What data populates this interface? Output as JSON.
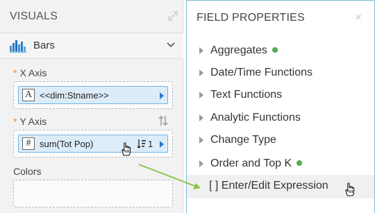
{
  "visuals": {
    "title": "VISUALS",
    "chart_type": "Bars",
    "x_axis": {
      "label": "X Axis",
      "required_mark": "*",
      "pill": {
        "type_glyph": "A",
        "text": "<<dim:Stname>>"
      }
    },
    "y_axis": {
      "label": "Y Axis",
      "required_mark": "*",
      "pill": {
        "type_glyph": "#",
        "text": "sum(Tot Pop)",
        "sort_order": "1"
      }
    },
    "colors": {
      "label": "Colors"
    }
  },
  "field_properties": {
    "title": "FIELD PROPERTIES",
    "close_glyph": "×",
    "items": [
      {
        "label": "Aggregates",
        "has_indicator": true
      },
      {
        "label": "Date/Time Functions",
        "has_indicator": false
      },
      {
        "label": "Text Functions",
        "has_indicator": false
      },
      {
        "label": "Analytic Functions",
        "has_indicator": false
      },
      {
        "label": "Change Type",
        "has_indicator": false
      },
      {
        "label": "Order and Top K",
        "has_indicator": true
      },
      {
        "label": "[ ] Enter/Edit Expression",
        "has_indicator": false,
        "highlighted": true
      }
    ]
  },
  "colors": {
    "required_star": "#f5821f",
    "pill_bg": "#dcecf9",
    "pill_border": "#6fb4e6",
    "indicator_green": "#4caf50",
    "annotation_arrow": "#8bc34a",
    "panel_border": "#7bb7d6"
  }
}
